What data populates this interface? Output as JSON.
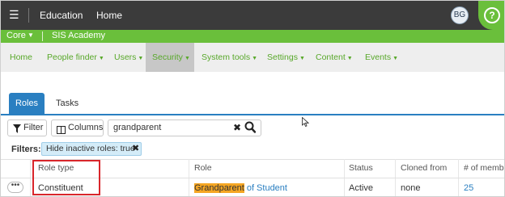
{
  "topbar": {
    "menu_icon": "hamburger-icon",
    "app_title": "Education",
    "home_label": "Home",
    "avatar_initials": "BG",
    "help_icon": "help-icon",
    "help_glyph": "?"
  },
  "context_bar": {
    "product": "Core",
    "school": "SIS Academy"
  },
  "nav": {
    "items": [
      {
        "label": "Home",
        "has_menu": false
      },
      {
        "label": "People finder",
        "has_menu": true
      },
      {
        "label": "Users",
        "has_menu": true
      },
      {
        "label": "Security",
        "has_menu": true,
        "active": true
      },
      {
        "label": "System tools",
        "has_menu": true
      },
      {
        "label": "Settings",
        "has_menu": true
      },
      {
        "label": "Content",
        "has_menu": true
      },
      {
        "label": "Events",
        "has_menu": true
      }
    ]
  },
  "tabs": [
    {
      "label": "Roles",
      "active": true
    },
    {
      "label": "Tasks",
      "active": false
    }
  ],
  "toolbar": {
    "filter_label": "Filter",
    "columns_label": "Columns",
    "search_value": "grandparent"
  },
  "filters": {
    "label": "Filters:",
    "chip": "Hide inactive roles: true"
  },
  "table": {
    "columns": [
      "Role type",
      "Role",
      "Status",
      "Cloned from",
      "# of memb"
    ],
    "rows": [
      {
        "role_type": "Constituent",
        "role_highlight": "Grandparent",
        "role_rest": " of Student",
        "status": "Active",
        "cloned_from": "none",
        "members": "25"
      }
    ]
  },
  "colors": {
    "topbar": "#3b3b3b",
    "brand_green": "#6abf3b",
    "accent_blue": "#2a7fc1",
    "highlight": "#f5a623",
    "annotation_red": "#d9262b"
  }
}
